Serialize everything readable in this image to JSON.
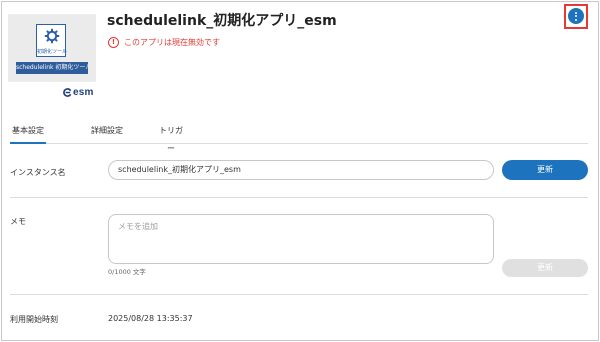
{
  "app": {
    "title": "schedulelink_初期化アプリ_esm",
    "status_text": "このアプリは現在無効です",
    "thumbnail": {
      "card_label": "初期化ツール",
      "banner": "schedulelink 初期化ツール"
    },
    "brand": "esm",
    "menu_icon": "more-vert-icon"
  },
  "tabs": [
    {
      "label": "基本設定",
      "active": true
    },
    {
      "label": "詳細設定",
      "active": false
    },
    {
      "label": "トリガー",
      "active": false
    }
  ],
  "instance": {
    "label": "インスタンス名",
    "value": "schedulelink_初期化アプリ_esm",
    "button": "更新"
  },
  "memo": {
    "label": "メモ",
    "placeholder": "メモを追加",
    "counter": "0/1000 文字",
    "button": "更新"
  },
  "started": {
    "label": "利用開始時刻",
    "value": "2025/08/28 13:35:37"
  },
  "colors": {
    "primary": "#1e73be",
    "danger": "#e53935",
    "disabled": "#e0e0e0",
    "banner": "#2f5d9b"
  }
}
